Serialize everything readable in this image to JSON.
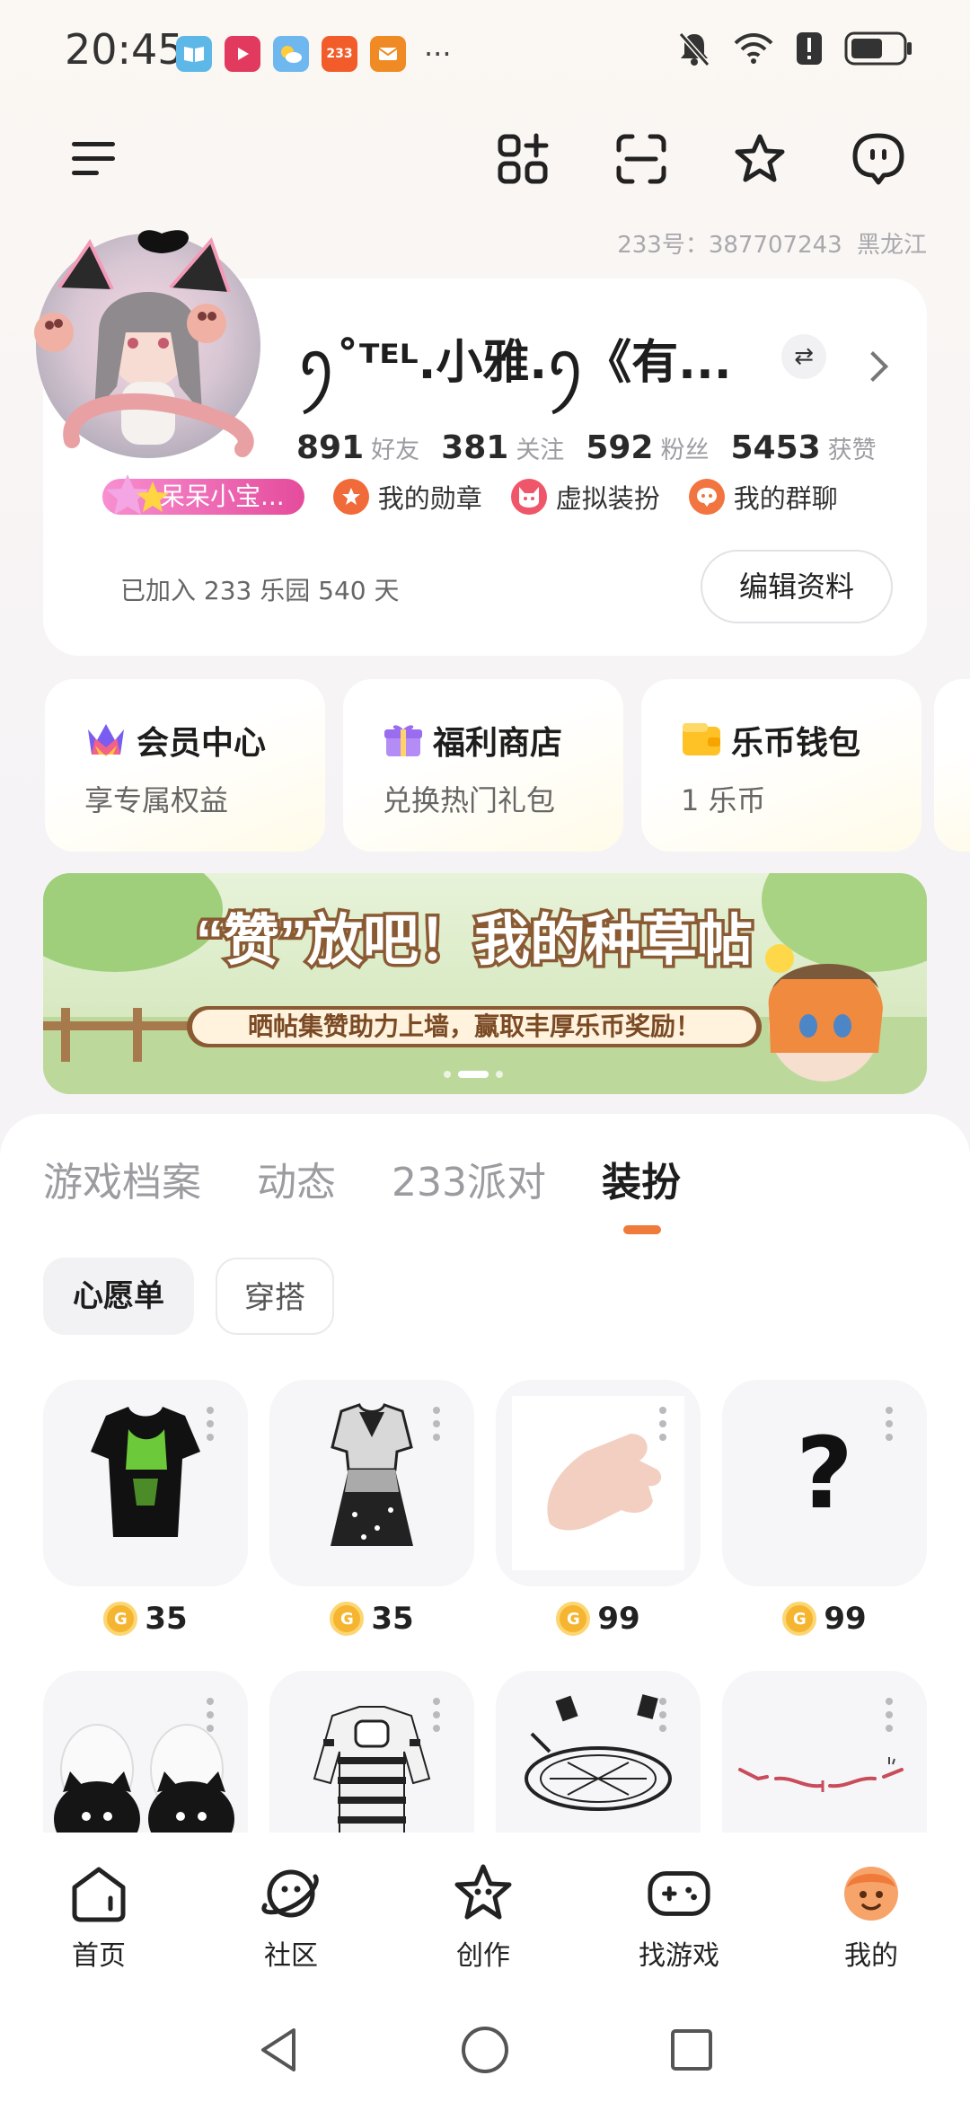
{
  "status_bar": {
    "time": "20:45",
    "app_233_label": "233",
    "more_dots": "···",
    "icons": [
      "book-app-icon",
      "video-app-icon",
      "weather-app-icon",
      "app-233-icon",
      "mail-app-icon",
      "mute-icon",
      "wifi-icon",
      "alert-icon",
      "battery-icon"
    ]
  },
  "header": {
    "icons": [
      "menu-icon",
      "grid-add-icon",
      "scan-icon",
      "star-icon",
      "message-icon"
    ],
    "id_label": "233号：387707243",
    "region": "黑龙江"
  },
  "profile": {
    "nickname": "ꪆ˚ᵀᴱᴸ.小雅.ꪆ《有...",
    "stats": [
      {
        "value": "891",
        "label": "好友"
      },
      {
        "value": "381",
        "label": "关注"
      },
      {
        "value": "592",
        "label": "粉丝"
      },
      {
        "value": "5453",
        "label": "获赞"
      }
    ],
    "level_badge": "呆呆小宝...",
    "entries": [
      {
        "label": "我的勋章",
        "icon": "medal-icon"
      },
      {
        "label": "虚拟装扮",
        "icon": "cat-face-icon"
      },
      {
        "label": "我的群聊",
        "icon": "group-chat-icon"
      }
    ],
    "joined_text": "已加入 233 乐园 540 天",
    "edit_button": "编辑资料",
    "swap_symbol": "⇄"
  },
  "quick_cards": [
    {
      "title": "会员中心",
      "subtitle": "享专属权益",
      "icon": "vip-crown-icon"
    },
    {
      "title": "福利商店",
      "subtitle": "兑换热门礼包",
      "icon": "gift-icon"
    },
    {
      "title": "乐币钱包",
      "subtitle": "1 乐币",
      "icon": "wallet-icon"
    }
  ],
  "banner": {
    "title": "“赞”放吧！我的种草帖",
    "subtitle": "晒帖集赞助力上墙，赢取丰厚乐币奖励！",
    "page_count": 3,
    "active_page": 2
  },
  "tabs": [
    {
      "label": "游戏档案",
      "active": false
    },
    {
      "label": "动态",
      "active": false
    },
    {
      "label": "233派对",
      "active": false
    },
    {
      "label": "装扮",
      "active": true
    }
  ],
  "chips": {
    "wishlist": "心愿单",
    "outfit": "穿搭"
  },
  "items": [
    {
      "name": "black-green-tshirt",
      "price": "35"
    },
    {
      "name": "black-white-dress",
      "price": "35"
    },
    {
      "name": "hand-item",
      "price": "99"
    },
    {
      "name": "mystery-item",
      "price": "99",
      "glyph": "?"
    },
    {
      "name": "cat-slippers",
      "price": null
    },
    {
      "name": "striped-sweater",
      "price": null
    },
    {
      "name": "magic-circle",
      "price": null
    },
    {
      "name": "face-accessory",
      "price": null
    }
  ],
  "coin_glyph": "G",
  "bottom_nav": [
    {
      "label": "首页",
      "icon": "home-icon"
    },
    {
      "label": "社区",
      "icon": "planet-icon"
    },
    {
      "label": "创作",
      "icon": "create-star-icon"
    },
    {
      "label": "找游戏",
      "icon": "gamepad-icon"
    },
    {
      "label": "我的",
      "icon": "profile-face-icon",
      "active": true
    }
  ],
  "system_nav": [
    "back-icon",
    "home-circle-icon",
    "recents-icon"
  ],
  "colors": {
    "accent": "#ef7a3a",
    "level_pink": "#e54b9c",
    "coin": "#f5b531",
    "background": "#f6f3f6"
  }
}
